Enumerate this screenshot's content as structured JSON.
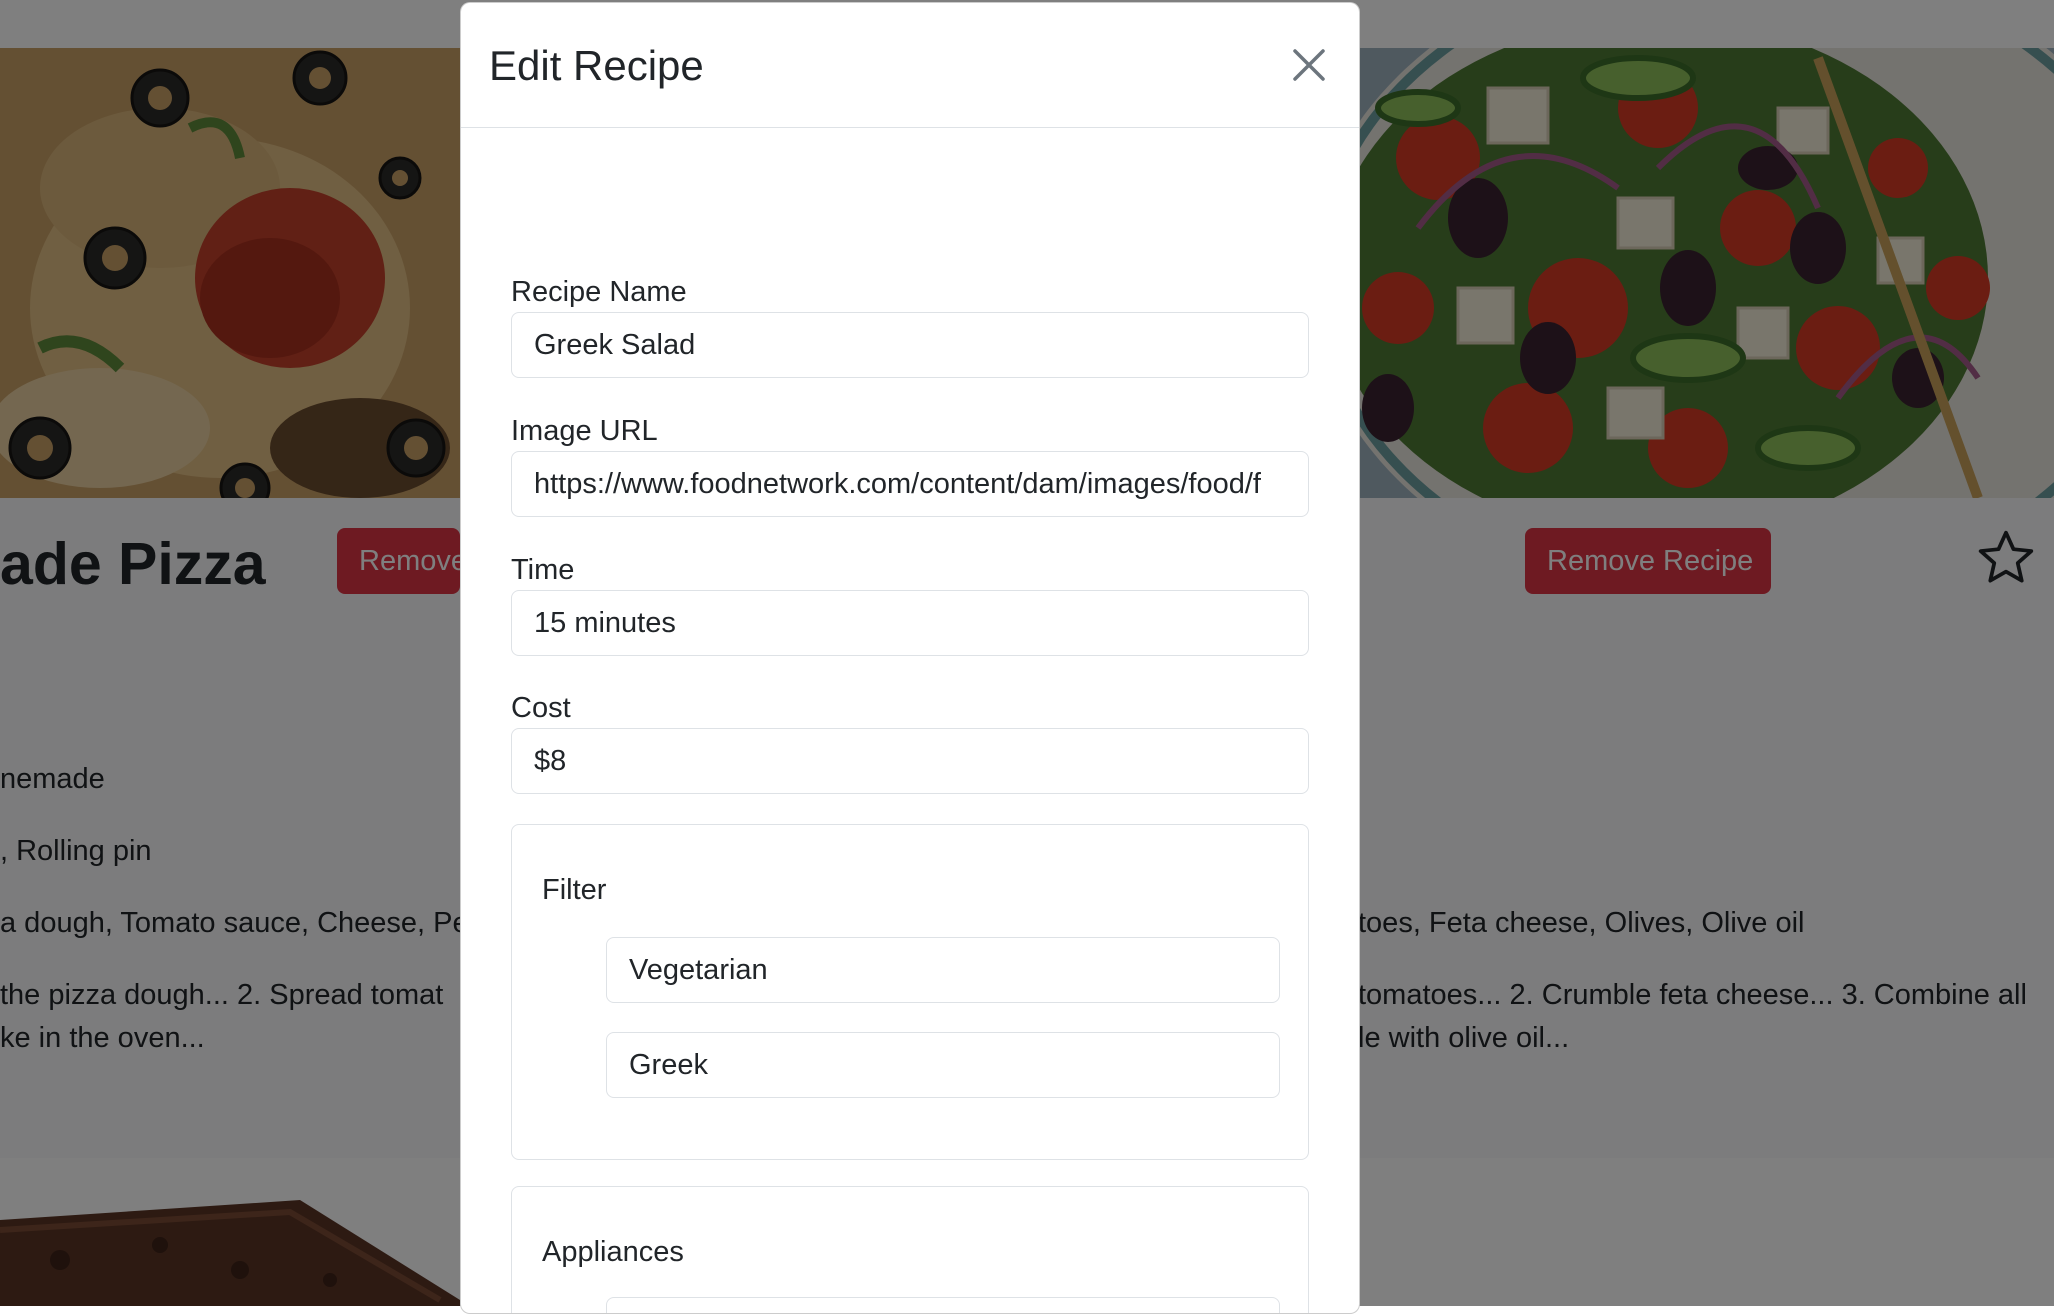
{
  "background": {
    "left_card": {
      "title": "ade Pizza",
      "remove_label": "Remove",
      "line1": "nemade",
      "line2": ", Rolling pin",
      "line3": "a dough, Tomato sauce, Cheese, Pep",
      "line4": " the pizza dough... 2. Spread tomat",
      "line5": "ke in the oven..."
    },
    "right_card": {
      "remove_label": "Remove Recipe",
      "line3": "toes, Feta cheese, Olives, Olive oil",
      "line4": " tomatoes... 2. Crumble feta cheese... 3. Combine all",
      "line5": "le with olive oil..."
    }
  },
  "modal": {
    "title": "Edit Recipe",
    "fields": {
      "name_label": "Recipe Name",
      "name_value": "Greek Salad",
      "image_label": "Image URL",
      "image_value": "https://www.foodnetwork.com/content/dam/images/food/f",
      "time_label": "Time",
      "time_value": "15 minutes",
      "cost_label": "Cost",
      "cost_value": "$8"
    },
    "filter": {
      "legend": "Filter",
      "items": [
        "Vegetarian",
        "Greek"
      ]
    },
    "appliances": {
      "legend": "Appliances"
    }
  },
  "colors": {
    "danger": "#dc3545",
    "backdrop": "rgba(0,0,0,0.5)",
    "border": "#dee2e6"
  }
}
